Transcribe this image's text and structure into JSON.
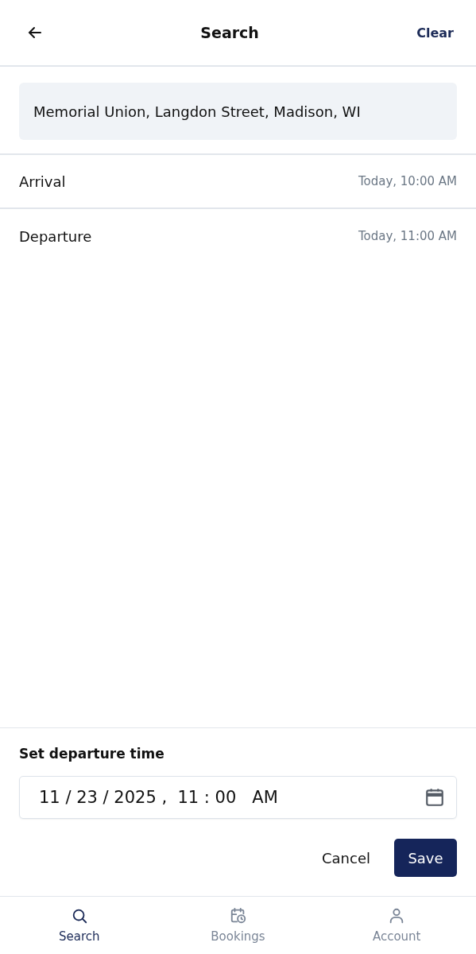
{
  "header": {
    "title": "Search",
    "action": "Clear"
  },
  "location": {
    "value": "Memorial Union, Langdon Street, Madison, WI"
  },
  "times": [
    {
      "label": "Arrival",
      "value": "Today, 10:00 AM"
    },
    {
      "label": "Departure",
      "value": "Today, 11:00 AM"
    }
  ],
  "sheet": {
    "title": "Set departure time",
    "value": "11 / 23 / 2025 ,  11 : 00   AM",
    "cancel": "Cancel",
    "save": "Save"
  },
  "nav": [
    {
      "label": "Search",
      "kind": "search",
      "selected": true
    },
    {
      "label": "Bookings",
      "kind": "bookings",
      "selected": false
    },
    {
      "label": "Account",
      "kind": "account",
      "selected": false
    }
  ]
}
